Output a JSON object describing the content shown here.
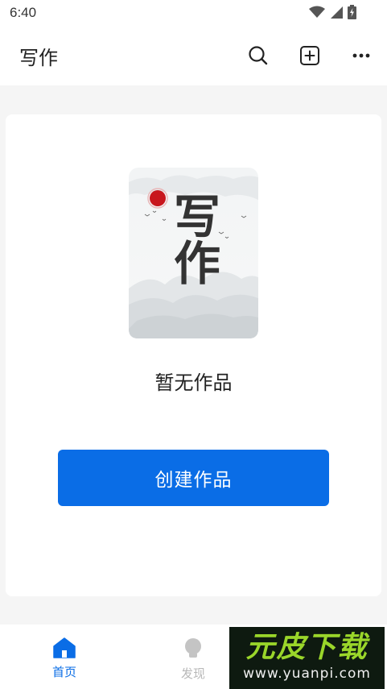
{
  "status_bar": {
    "time": "6:40"
  },
  "header": {
    "title": "写作",
    "search_icon": "search-icon",
    "add_icon": "add-square-icon",
    "more_icon": "more-horizontal-icon"
  },
  "main": {
    "illustration_text": "写作",
    "empty_text": "暂无作品",
    "create_button_label": "创建作品"
  },
  "bottom_nav": {
    "items": [
      {
        "label": "首页",
        "icon": "home-icon",
        "active": true
      },
      {
        "label": "发现",
        "icon": "lightbulb-icon",
        "active": false
      }
    ]
  },
  "watermark": {
    "logo": "元皮下载",
    "url": "www.yuanpi.com"
  },
  "colors": {
    "accent": "#0a6de6",
    "background": "#f5f5f5",
    "inactive": "#b8b8b8",
    "sun": "#c8161d"
  }
}
